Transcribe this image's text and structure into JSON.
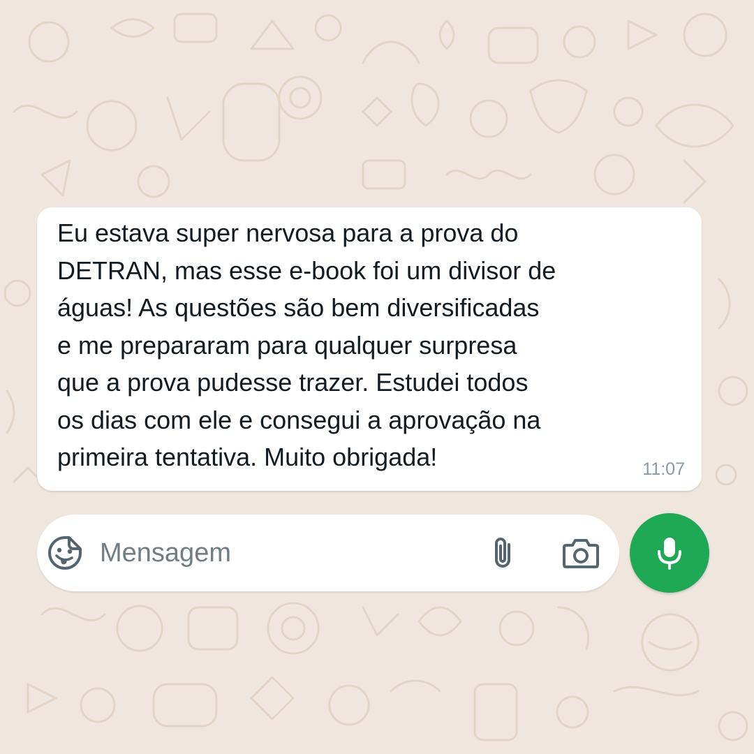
{
  "chat": {
    "message": {
      "text": "Eu estava super nervosa para a prova do\nDETRAN, mas esse e-book foi um divisor de\náguas! As questões são bem diversificadas\ne me prepararam para qualquer surpresa\nque a prova pudesse trazer. Estudei todos\nos dias com ele e consegui a aprovação na\nprimeira tentativa. Muito obrigada!",
      "time": "11:07"
    }
  },
  "composer": {
    "placeholder": "Mensagem",
    "value": ""
  },
  "icons": {
    "sticker": "sticker-smiley-icon",
    "attach": "paperclip-icon",
    "camera": "camera-icon",
    "mic": "microphone-icon"
  },
  "colors": {
    "wallpaper": "#efe7de",
    "wallpaper_doodle": "#e3d6c8",
    "bubble": "#ffffff",
    "text": "#111b21",
    "timestamp": "#8a9aa4",
    "icon": "#54656f",
    "mic_button": "#1fa855"
  }
}
